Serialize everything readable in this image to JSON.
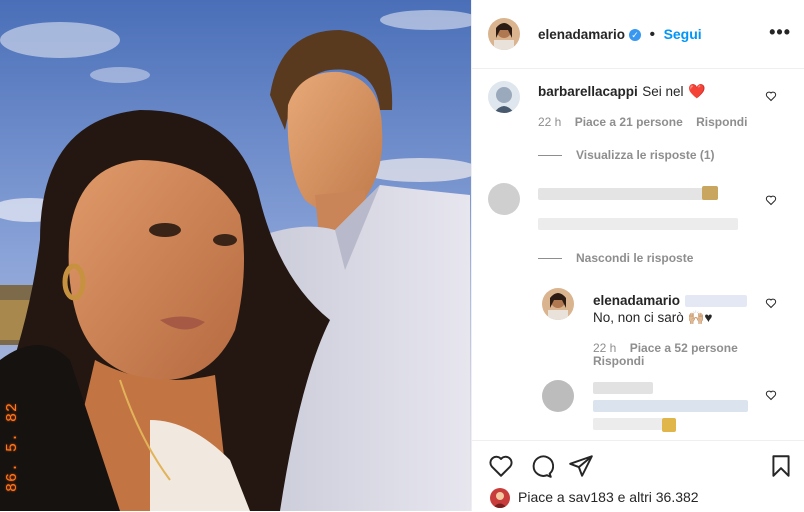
{
  "post": {
    "date_stamp": "86. 5. 82"
  },
  "header": {
    "username": "elenadamario",
    "follow_label": "Segui",
    "more_icon": "more-dots-icon"
  },
  "comments": [
    {
      "username": "barbarellacappi",
      "text": "Sei nel",
      "emoji": "❤️",
      "time": "22 h",
      "likes": "Piace a 21 persone",
      "reply": "Rispondi",
      "view_replies": "Visualizza le risposte (1)"
    },
    {
      "hide_replies": "Nascondi le risposte",
      "reply": {
        "username": "elenadamario",
        "text": "No, non ci sarò 🙌🏼♥",
        "time": "22 h",
        "likes": "Piace a 52 persone",
        "reply_label": "Rispondi"
      }
    }
  ],
  "footer": {
    "likes_text": "Piace a sav183 e altri 36.382"
  },
  "colors": {
    "accent": "#0095f6",
    "verified": "#3897f0",
    "text": "#262626",
    "muted": "#8e8e8e"
  }
}
